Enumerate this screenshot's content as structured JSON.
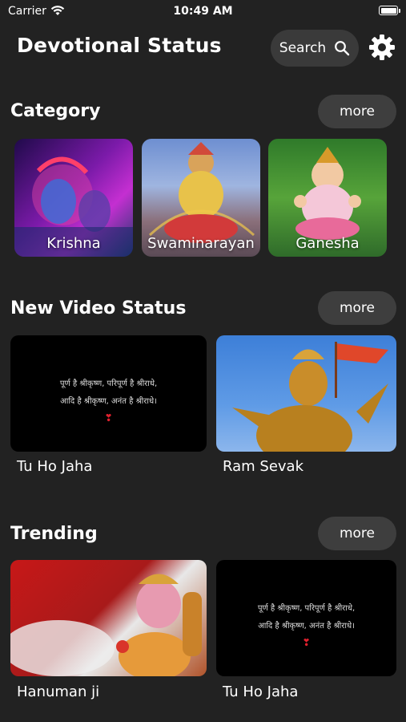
{
  "status_bar": {
    "carrier": "Carrier",
    "time": "10:49 AM"
  },
  "header": {
    "title": "Devotional Status",
    "search_label": "Search",
    "search_icon": "search-icon",
    "settings_icon": "gear-icon"
  },
  "sections": {
    "category": {
      "title": "Category",
      "more_label": "more",
      "items": [
        {
          "label": "Krishna",
          "accent": "#8a1fb5"
        },
        {
          "label": "Swaminarayan",
          "accent": "#c9942f"
        },
        {
          "label": "Ganesha",
          "accent": "#3f8a2a"
        }
      ]
    },
    "new_video": {
      "title": "New Video Status",
      "more_label": "more",
      "items": [
        {
          "caption": "Tu Ho Jaha",
          "quote_line1": "पूर्ण है श्रीकृष्ण, परिपूर्ण है श्रीराधे,",
          "quote_line2": "आदि है श्रीकृष्ण, अनंत है श्रीराधे।"
        },
        {
          "caption": "Ram Sevak"
        }
      ]
    },
    "trending": {
      "title": "Trending",
      "more_label": "more",
      "items": [
        {
          "caption": "Hanuman ji"
        },
        {
          "caption": "Tu Ho Jaha",
          "quote_line1": "पूर्ण है श्रीकृष्ण, परिपूर्ण है श्रीराधे,",
          "quote_line2": "आदि है श्रीकृष्ण, अनंत है श्रीराधे।"
        }
      ]
    }
  }
}
